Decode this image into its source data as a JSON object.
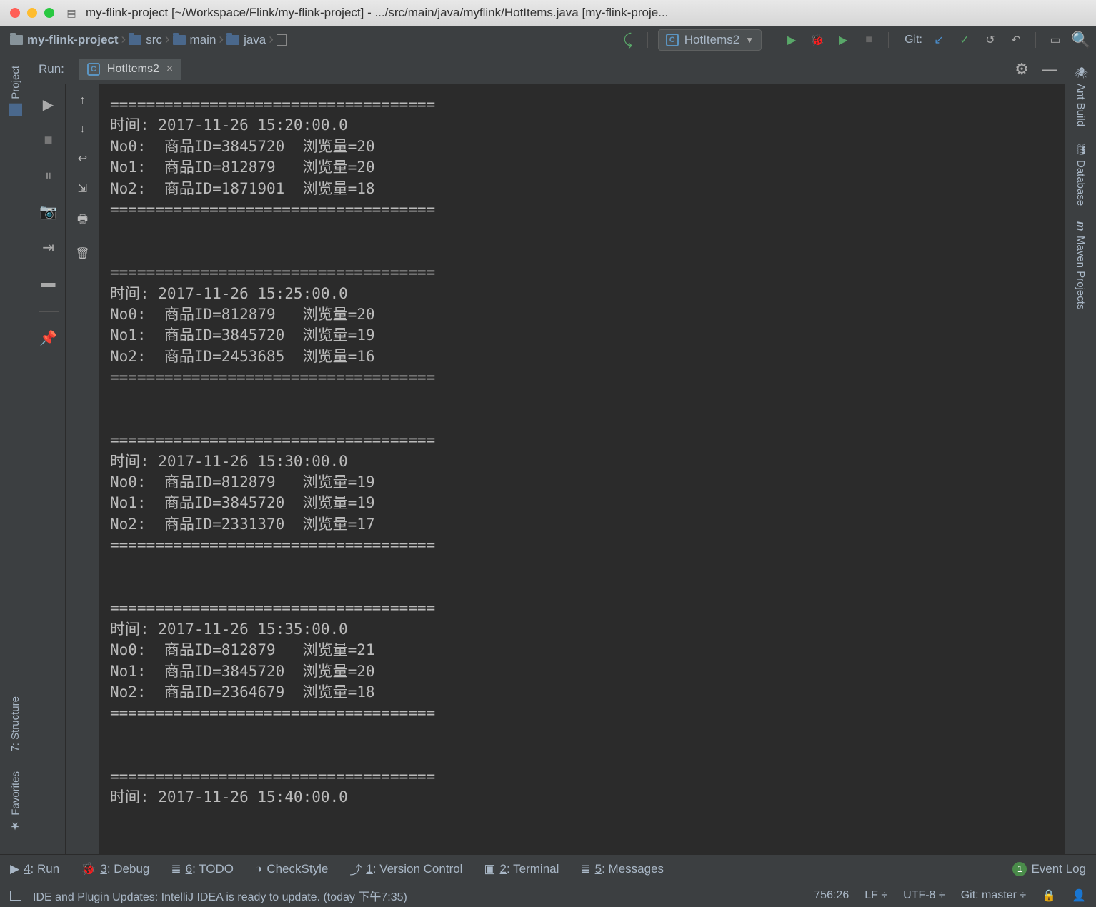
{
  "titlebar": {
    "title": "my-flink-project [~/Workspace/Flink/my-flink-project] - .../src/main/java/myflink/HotItems.java [my-flink-proje..."
  },
  "breadcrumb": {
    "items": [
      "my-flink-project",
      "src",
      "main",
      "java"
    ]
  },
  "runconfig": {
    "selected": "HotItems2"
  },
  "git": {
    "label": "Git:"
  },
  "run_panel": {
    "label": "Run:",
    "tab": "HotItems2"
  },
  "left_tabs": {
    "project": "Project",
    "structure": "7: Structure",
    "favorites": "Favorites"
  },
  "right_tabs": {
    "ant": "Ant Build",
    "database": "Database",
    "maven": "Maven Projects"
  },
  "console_output": "====================================\n时间: 2017-11-26 15:20:00.0\nNo0:  商品ID=3845720  浏览量=20\nNo1:  商品ID=812879   浏览量=20\nNo2:  商品ID=1871901  浏览量=18\n====================================\n\n\n====================================\n时间: 2017-11-26 15:25:00.0\nNo0:  商品ID=812879   浏览量=20\nNo1:  商品ID=3845720  浏览量=19\nNo2:  商品ID=2453685  浏览量=16\n====================================\n\n\n====================================\n时间: 2017-11-26 15:30:00.0\nNo0:  商品ID=812879   浏览量=19\nNo1:  商品ID=3845720  浏览量=19\nNo2:  商品ID=2331370  浏览量=17\n====================================\n\n\n====================================\n时间: 2017-11-26 15:35:00.0\nNo0:  商品ID=812879   浏览量=21\nNo1:  商品ID=3845720  浏览量=20\nNo2:  商品ID=2364679  浏览量=18\n====================================\n\n\n====================================\n时间: 2017-11-26 15:40:00.0",
  "bottom": {
    "run": "4: Run",
    "debug": "3: Debug",
    "todo": "6: TODO",
    "checkstyle": "CheckStyle",
    "vcs": "1: Version Control",
    "terminal": "2: Terminal",
    "messages": "5: Messages",
    "event": "Event Log",
    "event_badge": "1"
  },
  "status": {
    "msg": "IDE and Plugin Updates: IntelliJ IDEA is ready to update. (today 下午7:35)",
    "pos": "756:26",
    "sep": "LF",
    "enc": "UTF-8",
    "git": "Git: master"
  }
}
